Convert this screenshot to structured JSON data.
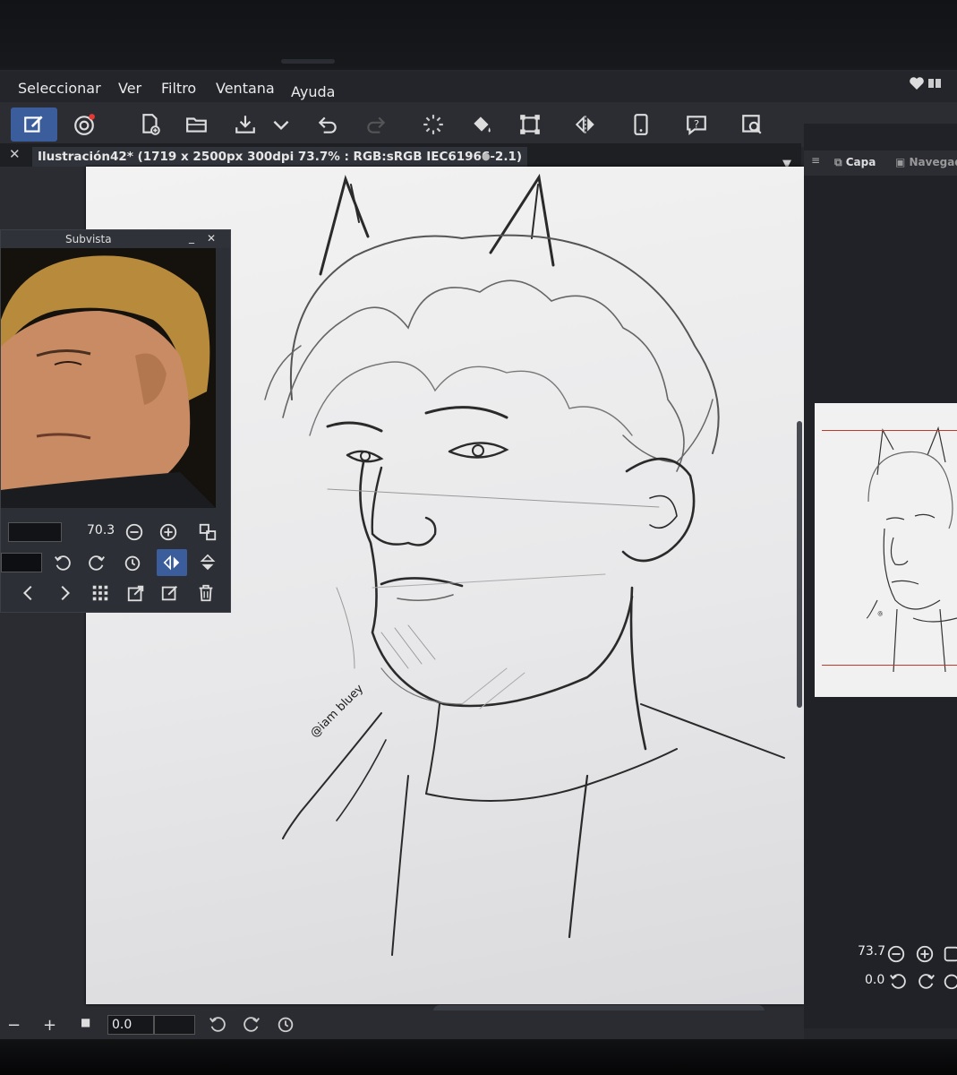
{
  "menubar": {
    "items": [
      "Seleccionar",
      "Ver",
      "Filtro",
      "Ventana",
      "Ayuda"
    ]
  },
  "toolbar": {
    "icons": [
      "edit-mode-icon",
      "companion-icon",
      "new-file-icon",
      "open-folder-icon",
      "save-icon",
      "dropdown-chevron-icon",
      "undo-icon",
      "redo-icon",
      "loading-icon",
      "fill-icon",
      "transform-icon",
      "flip-icon",
      "mobile-icon",
      "help-icon",
      "search-view-icon"
    ]
  },
  "document_tab": {
    "close": "✕",
    "title": "Ilustración42* (1719 x 2500px 300dpi 73.7% : RGB:sRGB IEC61966-2.1)",
    "dot": "●"
  },
  "canvas": {
    "signature": "@iam bluey"
  },
  "subvista": {
    "title": "Subvista",
    "zoom": "70.3"
  },
  "right_panel": {
    "menu_icon": "≡",
    "tab_layer": "Capa",
    "tab_navigator": "Navegador",
    "zoom": "73.7",
    "angle": "0.0"
  },
  "bottom_bar": {
    "minus": "−",
    "plus": "+",
    "angle": "0.0"
  },
  "colors": {
    "accent": "#3b5d9b",
    "panel": "#2b2d33",
    "canvas": "#efefef",
    "nav_frame": "#c0392b"
  }
}
